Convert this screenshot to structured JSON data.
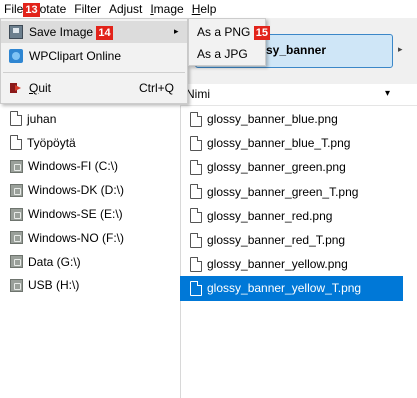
{
  "menubar": {
    "file": "File",
    "file_badge": "13",
    "rotate_rest": "otate",
    "filter": "Filter",
    "adjust": "Adjust",
    "image_mn": "I",
    "image_rest": "mage",
    "help_mn": "H",
    "help_rest": "elp"
  },
  "file_menu": {
    "save_image": "Save Image",
    "save_badge": "14",
    "save_arrow": "▸",
    "wpclipart": "WPClipart Online",
    "quit_mn": "Q",
    "quit_rest": "uit",
    "quit_shortcut": "Ctrl+Q"
  },
  "save_submenu": {
    "png": "As a PNG",
    "png_badge": "15",
    "jpg": "As a JPG"
  },
  "filename_box": "sy_banner",
  "toolbar_arrow": "▸",
  "column_header": {
    "label": "Nimi",
    "arrow": "▾"
  },
  "drives": [
    {
      "label": "juhan",
      "icon": "document-icon"
    },
    {
      "label": "Työpöytä",
      "icon": "document-icon"
    },
    {
      "label": "Windows-FI (C:\\)",
      "icon": "drive-icon"
    },
    {
      "label": "Windows-DK (D:\\)",
      "icon": "drive-icon"
    },
    {
      "label": "Windows-SE (E:\\)",
      "icon": "drive-icon"
    },
    {
      "label": "Windows-NO (F:\\)",
      "icon": "drive-icon"
    },
    {
      "label": "Data (G:\\)",
      "icon": "drive-icon"
    },
    {
      "label": "USB (H:\\)",
      "icon": "drive-icon"
    }
  ],
  "files": [
    {
      "name": "glossy_banner_blue.png"
    },
    {
      "name": "glossy_banner_blue_T.png"
    },
    {
      "name": "glossy_banner_green.png"
    },
    {
      "name": "glossy_banner_green_T.png"
    },
    {
      "name": "glossy_banner_red.png"
    },
    {
      "name": "glossy_banner_red_T.png"
    },
    {
      "name": "glossy_banner_yellow.png"
    },
    {
      "name": "glossy_banner_yellow_T.png"
    }
  ],
  "selected_file": "glossy_banner_yellow_T.png",
  "colors": {
    "badge": "#e2231a",
    "selection": "#0078d7",
    "filename_box": "#cfe6f7"
  }
}
